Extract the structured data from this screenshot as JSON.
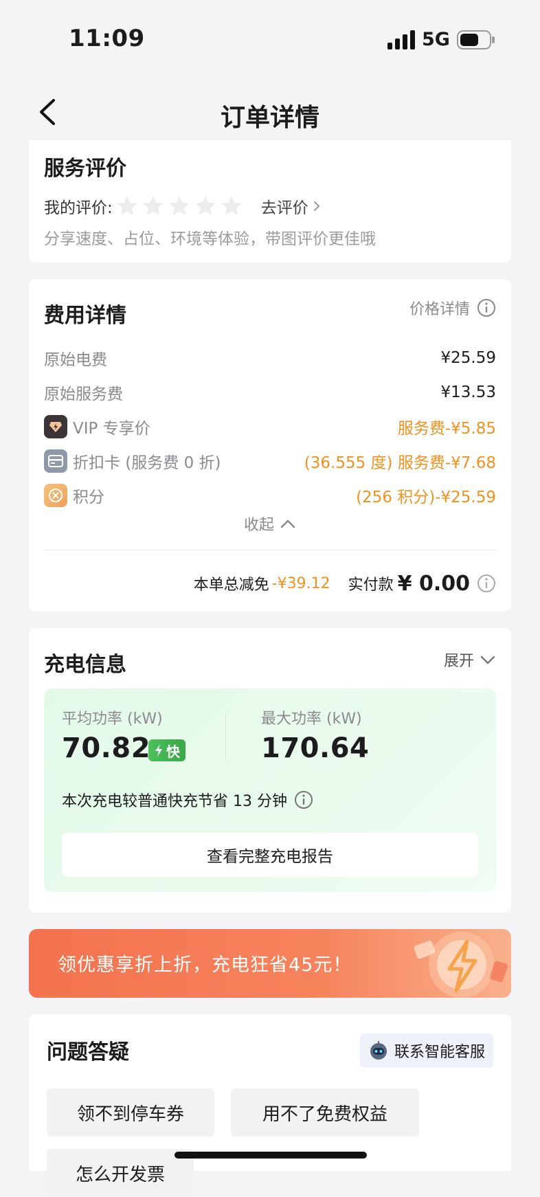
{
  "status_bar": {
    "time": "11:09",
    "network": "5G"
  },
  "nav": {
    "title": "订单详情",
    "back_icon": "chevron-left-icon"
  },
  "rating": {
    "title": "服务评价",
    "my_rating_label": "我的评价:",
    "stars_total": 5,
    "stars_filled": 0,
    "go_rate": "去评价",
    "hint": "分享速度、占位、环境等体验，带图评价更佳哦"
  },
  "fee": {
    "title": "费用详情",
    "price_detail": "价格详情",
    "rows": [
      {
        "label": "原始电费",
        "value": "¥25.59"
      },
      {
        "label": "原始服务费",
        "value": "¥13.53"
      },
      {
        "label": "VIP 专享价",
        "value": "服务费-¥5.85",
        "icon": "vip-diamond-icon"
      },
      {
        "label": "折扣卡 (服务费 0 折)",
        "value": "(36.555 度) 服务费-¥7.68",
        "icon": "card-icon"
      },
      {
        "label": "积分",
        "value": "(256 积分)-¥25.59",
        "icon": "points-coin-icon"
      }
    ],
    "collapse": "收起",
    "total_label": "本单总减免",
    "total_value": "-¥39.12",
    "paid_label": "实付款",
    "paid_value": "¥ 0.00"
  },
  "charge": {
    "title": "充电信息",
    "expand": "展开",
    "avg_power_label": "平均功率 (kW)",
    "avg_power_value": "70.82",
    "fast_badge": "快",
    "max_power_label": "最大功率 (kW)",
    "max_power_value": "170.64",
    "save_note": "本次充电较普通快充节省 13 分钟",
    "report_button": "查看完整充电报告"
  },
  "promo": {
    "text": "领优惠享折上折，充电狂省45元！"
  },
  "qa": {
    "title": "问题答疑",
    "cs_button": "联系智能客服",
    "chips": [
      "领不到停车券",
      "用不了免费权益",
      "怎么开发票"
    ]
  },
  "colors": {
    "accent_orange": "#f0921e",
    "promo_bg": "#f4724e",
    "panel_green": "#e3f9e8",
    "fast_green": "#4cbf5a"
  }
}
